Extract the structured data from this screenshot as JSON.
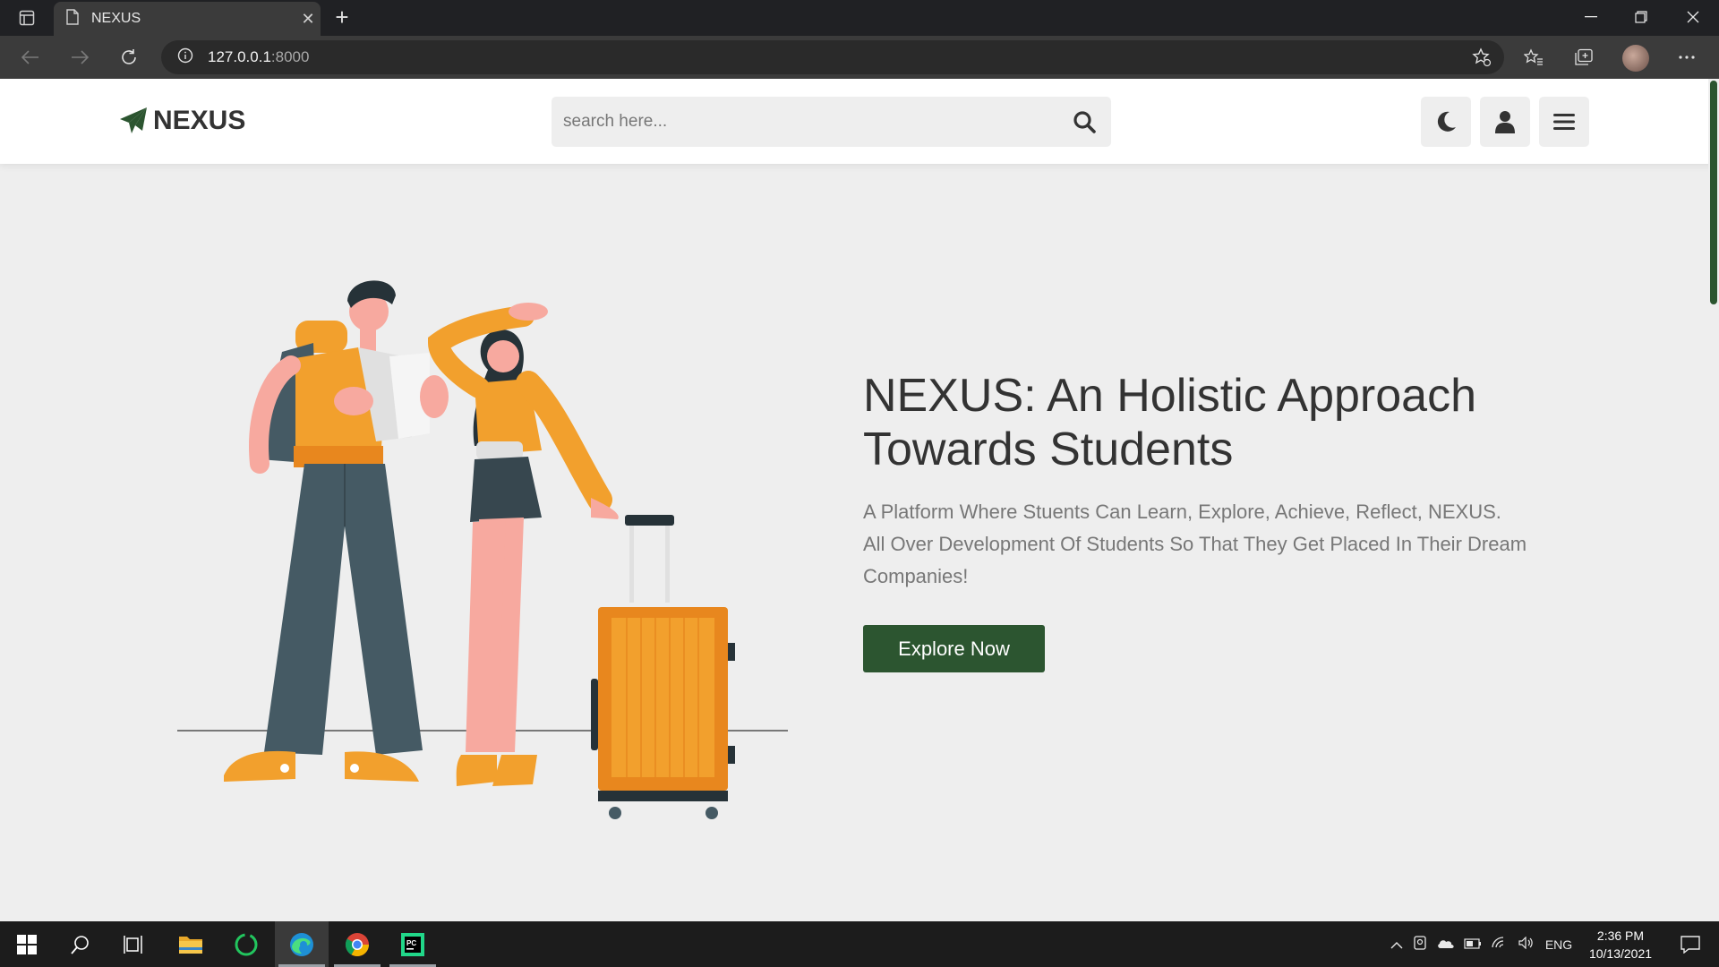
{
  "browser": {
    "tab_title": "NEXUS",
    "tab_close": "✕",
    "new_tab": "+",
    "url_host": "127.0.0.1",
    "url_port": ":8000"
  },
  "site": {
    "logo_text": "NEXUS",
    "search_placeholder": "search here...",
    "brand_color": "#2c5530"
  },
  "hero": {
    "title": "NEXUS: An Holistic Approach Towards Students",
    "line1": "A Platform Where Stuents Can Learn, Explore, Achieve, Reflect, NEXUS.",
    "line2": "All Over Development Of Students So That They Get Placed In Their Dream Companies!",
    "cta": "Explore Now"
  },
  "taskbar": {
    "language": "ENG",
    "time": "2:36 PM",
    "date": "10/13/2021"
  }
}
